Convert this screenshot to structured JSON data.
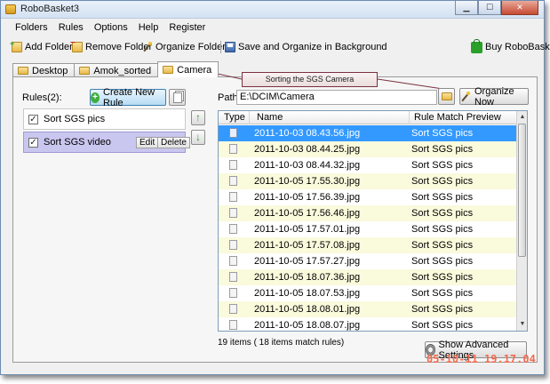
{
  "window": {
    "title": "RoboBasket3"
  },
  "menu": [
    "Folders",
    "Rules",
    "Options",
    "Help",
    "Register"
  ],
  "toolbar": {
    "add_folder": "Add Folder",
    "remove_folder": "Remove Folder",
    "organize_folders": "Organize Folders",
    "save_organize": "Save and Organize in Background",
    "buy": "Buy RoboBasket"
  },
  "tabs": [
    "Desktop",
    "Amok_sorted",
    "Camera"
  ],
  "active_tab": "Camera",
  "callout": "Sorting the SGS Camera",
  "rules": {
    "label": "Rules(2):",
    "create_button": "Create New Rule",
    "items": [
      {
        "label": "Sort SGS pics",
        "checked": true,
        "selected": false
      },
      {
        "label": "Sort SGS video",
        "checked": true,
        "selected": true,
        "edit": "Edit",
        "delete": "Delete"
      }
    ]
  },
  "path": {
    "label": "Path:",
    "value": "E:\\DCIM\\Camera"
  },
  "organize_button": "Organize Now",
  "grid": {
    "columns": [
      "Type",
      "Name",
      "Rule Match Preview"
    ],
    "rows": [
      {
        "name": "2011-10-03 08.43.56.jpg",
        "rule": "Sort SGS pics"
      },
      {
        "name": "2011-10-03 08.44.25.jpg",
        "rule": "Sort SGS pics"
      },
      {
        "name": "2011-10-03 08.44.32.jpg",
        "rule": "Sort SGS pics"
      },
      {
        "name": "2011-10-05 17.55.30.jpg",
        "rule": "Sort SGS pics"
      },
      {
        "name": "2011-10-05 17.56.39.jpg",
        "rule": "Sort SGS pics"
      },
      {
        "name": "2011-10-05 17.56.46.jpg",
        "rule": "Sort SGS pics"
      },
      {
        "name": "2011-10-05 17.57.01.jpg",
        "rule": "Sort SGS pics"
      },
      {
        "name": "2011-10-05 17.57.08.jpg",
        "rule": "Sort SGS pics"
      },
      {
        "name": "2011-10-05 17.57.27.jpg",
        "rule": "Sort SGS pics"
      },
      {
        "name": "2011-10-05 18.07.36.jpg",
        "rule": "Sort SGS pics"
      },
      {
        "name": "2011-10-05 18.07.53.jpg",
        "rule": "Sort SGS pics"
      },
      {
        "name": "2011-10-05 18.08.01.jpg",
        "rule": "Sort SGS pics"
      },
      {
        "name": "2011-10-05 18.08.07.jpg",
        "rule": "Sort SGS pics"
      }
    ],
    "selected_row": 0
  },
  "status": "19 items  ( 18 items match rules)",
  "advanced_button": "Show Advanced Settings",
  "timestamp": "05-10-11 19.17.04",
  "icons": {
    "app": "robobasket-app-icon",
    "add_folder": "folder-add-icon",
    "remove_folder": "folder-remove-icon",
    "organize": "magic-wand-icon",
    "save": "save-disk-icon",
    "buy": "shopping-bag-icon",
    "tab": "folder-icon",
    "create_rule": "plus-circle-icon",
    "copy_rule": "copy-icon",
    "move_up": "arrow-up-icon",
    "move_down": "arrow-down-icon",
    "browse": "folder-open-icon",
    "organize_now": "magic-wand-icon",
    "file": "file-icon",
    "advanced": "gear-icon"
  },
  "colors": {
    "selection": "#3399ff",
    "alt_row": "#fafadc",
    "rule_selected": "#c9c6ef",
    "timestamp": "#f26b4f"
  }
}
